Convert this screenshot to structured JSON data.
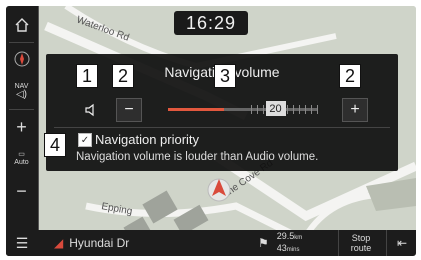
{
  "clock": {
    "time": "16:29"
  },
  "map": {
    "streets": [
      "Waterloo Rd",
      "Lane Cove Rd",
      "Epping"
    ],
    "current_road": "Hyundai Dr"
  },
  "sidebar": {
    "nav_label": "NAV",
    "auto_label": "Auto"
  },
  "popup": {
    "title": "Navigation volume",
    "decrease_label": "−",
    "increase_label": "+",
    "volume_value": "20",
    "volume_level_fraction": 0.37,
    "priority_label": "Navigation priority",
    "priority_checked": true,
    "priority_description": "Navigation volume is louder than Audio volume."
  },
  "bottom": {
    "distance": "29.5",
    "distance_unit": "km",
    "time": "43",
    "time_unit": "mins",
    "stop_route_label": "Stop\nroute"
  },
  "callouts": [
    "1",
    "2",
    "3",
    "2",
    "4"
  ],
  "colors": {
    "slider_fill": "#e2583e",
    "accent_cursor": "#d94a3c",
    "background": "#0e0e0e"
  }
}
